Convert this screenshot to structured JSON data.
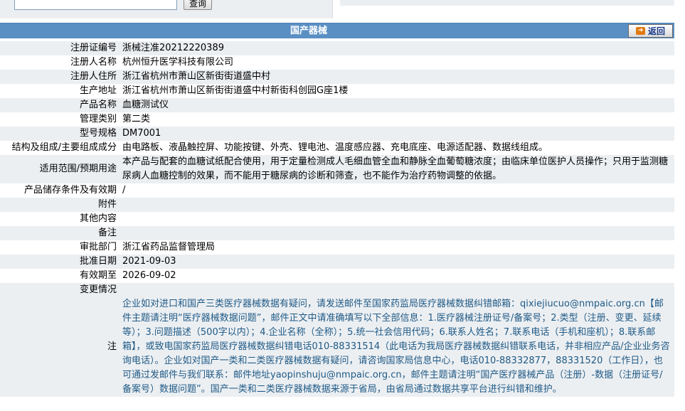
{
  "search": {
    "input_value": "",
    "query_label": "查询"
  },
  "header": {
    "title": "国产器械",
    "back_label": "返回"
  },
  "rows": [
    {
      "label": "注册证编号",
      "value": "浙械注准20212220389"
    },
    {
      "label": "注册人名称",
      "value": "杭州恒升医学科技有限公司"
    },
    {
      "label": "注册人住所",
      "value": "浙江省杭州市萧山区新街街道盛中村"
    },
    {
      "label": "生产地址",
      "value": "浙江省杭州市萧山区新街街道盛中村新街科创园G座1楼"
    },
    {
      "label": "产品名称",
      "value": "血糖测试仪"
    },
    {
      "label": "管理类别",
      "value": "第二类"
    },
    {
      "label": "型号规格",
      "value": "DM7001"
    },
    {
      "label": "结构及组成/主要组成成分",
      "value": "由电路板、液晶触控屏、功能按键、外壳、锂电池、温度感应器、充电底座、电源适配器、数据线组成。"
    },
    {
      "label": "适用范围/预期用途",
      "value": "本产品与配套的血糖试纸配合使用，用于定量检测成人毛细血管全血和静脉全血葡萄糖浓度；由临床单位医护人员操作；只用于监测糖尿病人血糖控制的效果，而不能用于糖尿病的诊断和筛查，也不能作为治疗药物调整的依据。"
    },
    {
      "label": "产品储存条件及有效期",
      "value": "/"
    },
    {
      "label": "附件",
      "value": ""
    },
    {
      "label": "其他内容",
      "value": ""
    },
    {
      "label": "备注",
      "value": ""
    },
    {
      "label": "审批部门",
      "value": "浙江省药品监督管理局"
    },
    {
      "label": "批准日期",
      "value": "2021-09-03"
    },
    {
      "label": "有效期至",
      "value": "2026-09-02"
    },
    {
      "label": "变更情况",
      "value": ""
    }
  ],
  "note": {
    "label": "注",
    "text": "企业如对进口和国产三类医疗器械数据有疑问，请发送邮件至国家药监局医疗器械数据纠错邮箱：qixiejiucuo@nmpaic.org.cn【邮件主题请注明“医疗器械数据问题”，邮件正文中请准确填写以下全部信息：1.医疗器械注册证号/备案号；2.类型（注册、变更、延续等）；3.问题描述（500字以内）；4.企业名称（全称）；5.统一社会信用代码；6.联系人姓名；7.联系电话（手机和座机）；8.联系邮箱】，或致电国家药监局医疗器械数据纠错电话010-88331514（此电话为我局医疗器械数据纠错联系电话，并非相应产品/企业业务咨询电话）。企业如对国产一类和二类医疗器械数据有疑问，请咨询国家局信息中心，电话010-88332877，88331520（工作日），也可通过发邮件与我们联系：邮件地址yaopinshuju@nmpaic.org.cn，邮件主题请注明“国产医疗器械产品（注册）-数据（注册证号/备案号）数据问题”。国产一类和二类医疗器械数据来源于省局，由省局通过数据共享平台进行纠错和维护。"
  },
  "colors": {
    "header_bg": "#5a8fc3",
    "row_alt_bg": "#eceff2",
    "note_text": "#1f5a86"
  }
}
